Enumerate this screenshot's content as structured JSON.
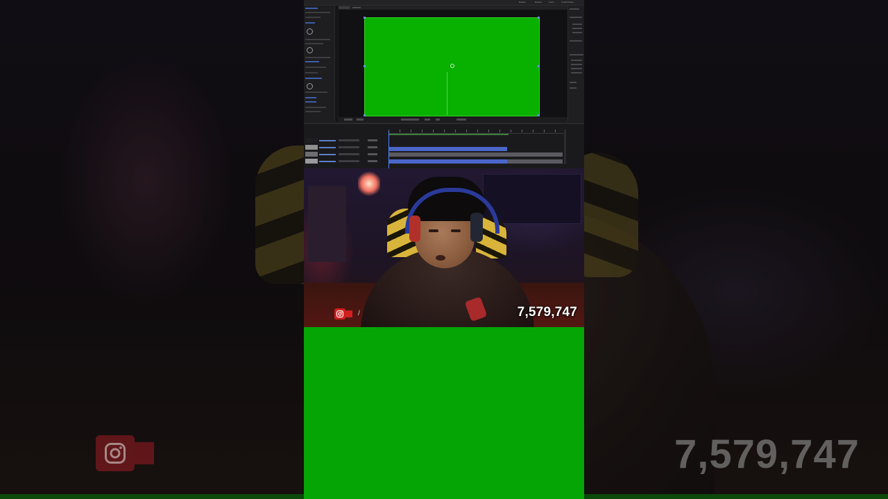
{
  "overlay": {
    "view_count": "7,579,747",
    "slash": "/",
    "social_icon": "instagram-icon",
    "social_color": "#d0201e"
  },
  "editor": {
    "app": "After Effects",
    "comp_background": "#08b100",
    "menu": [
      "Default",
      "Review",
      "Learn",
      "Small Screen"
    ]
  },
  "colors": {
    "green_screen": "#05a505",
    "timeline_layer_blue": "#4a66c9",
    "timeline_layer_gray": "#5a5a60"
  }
}
